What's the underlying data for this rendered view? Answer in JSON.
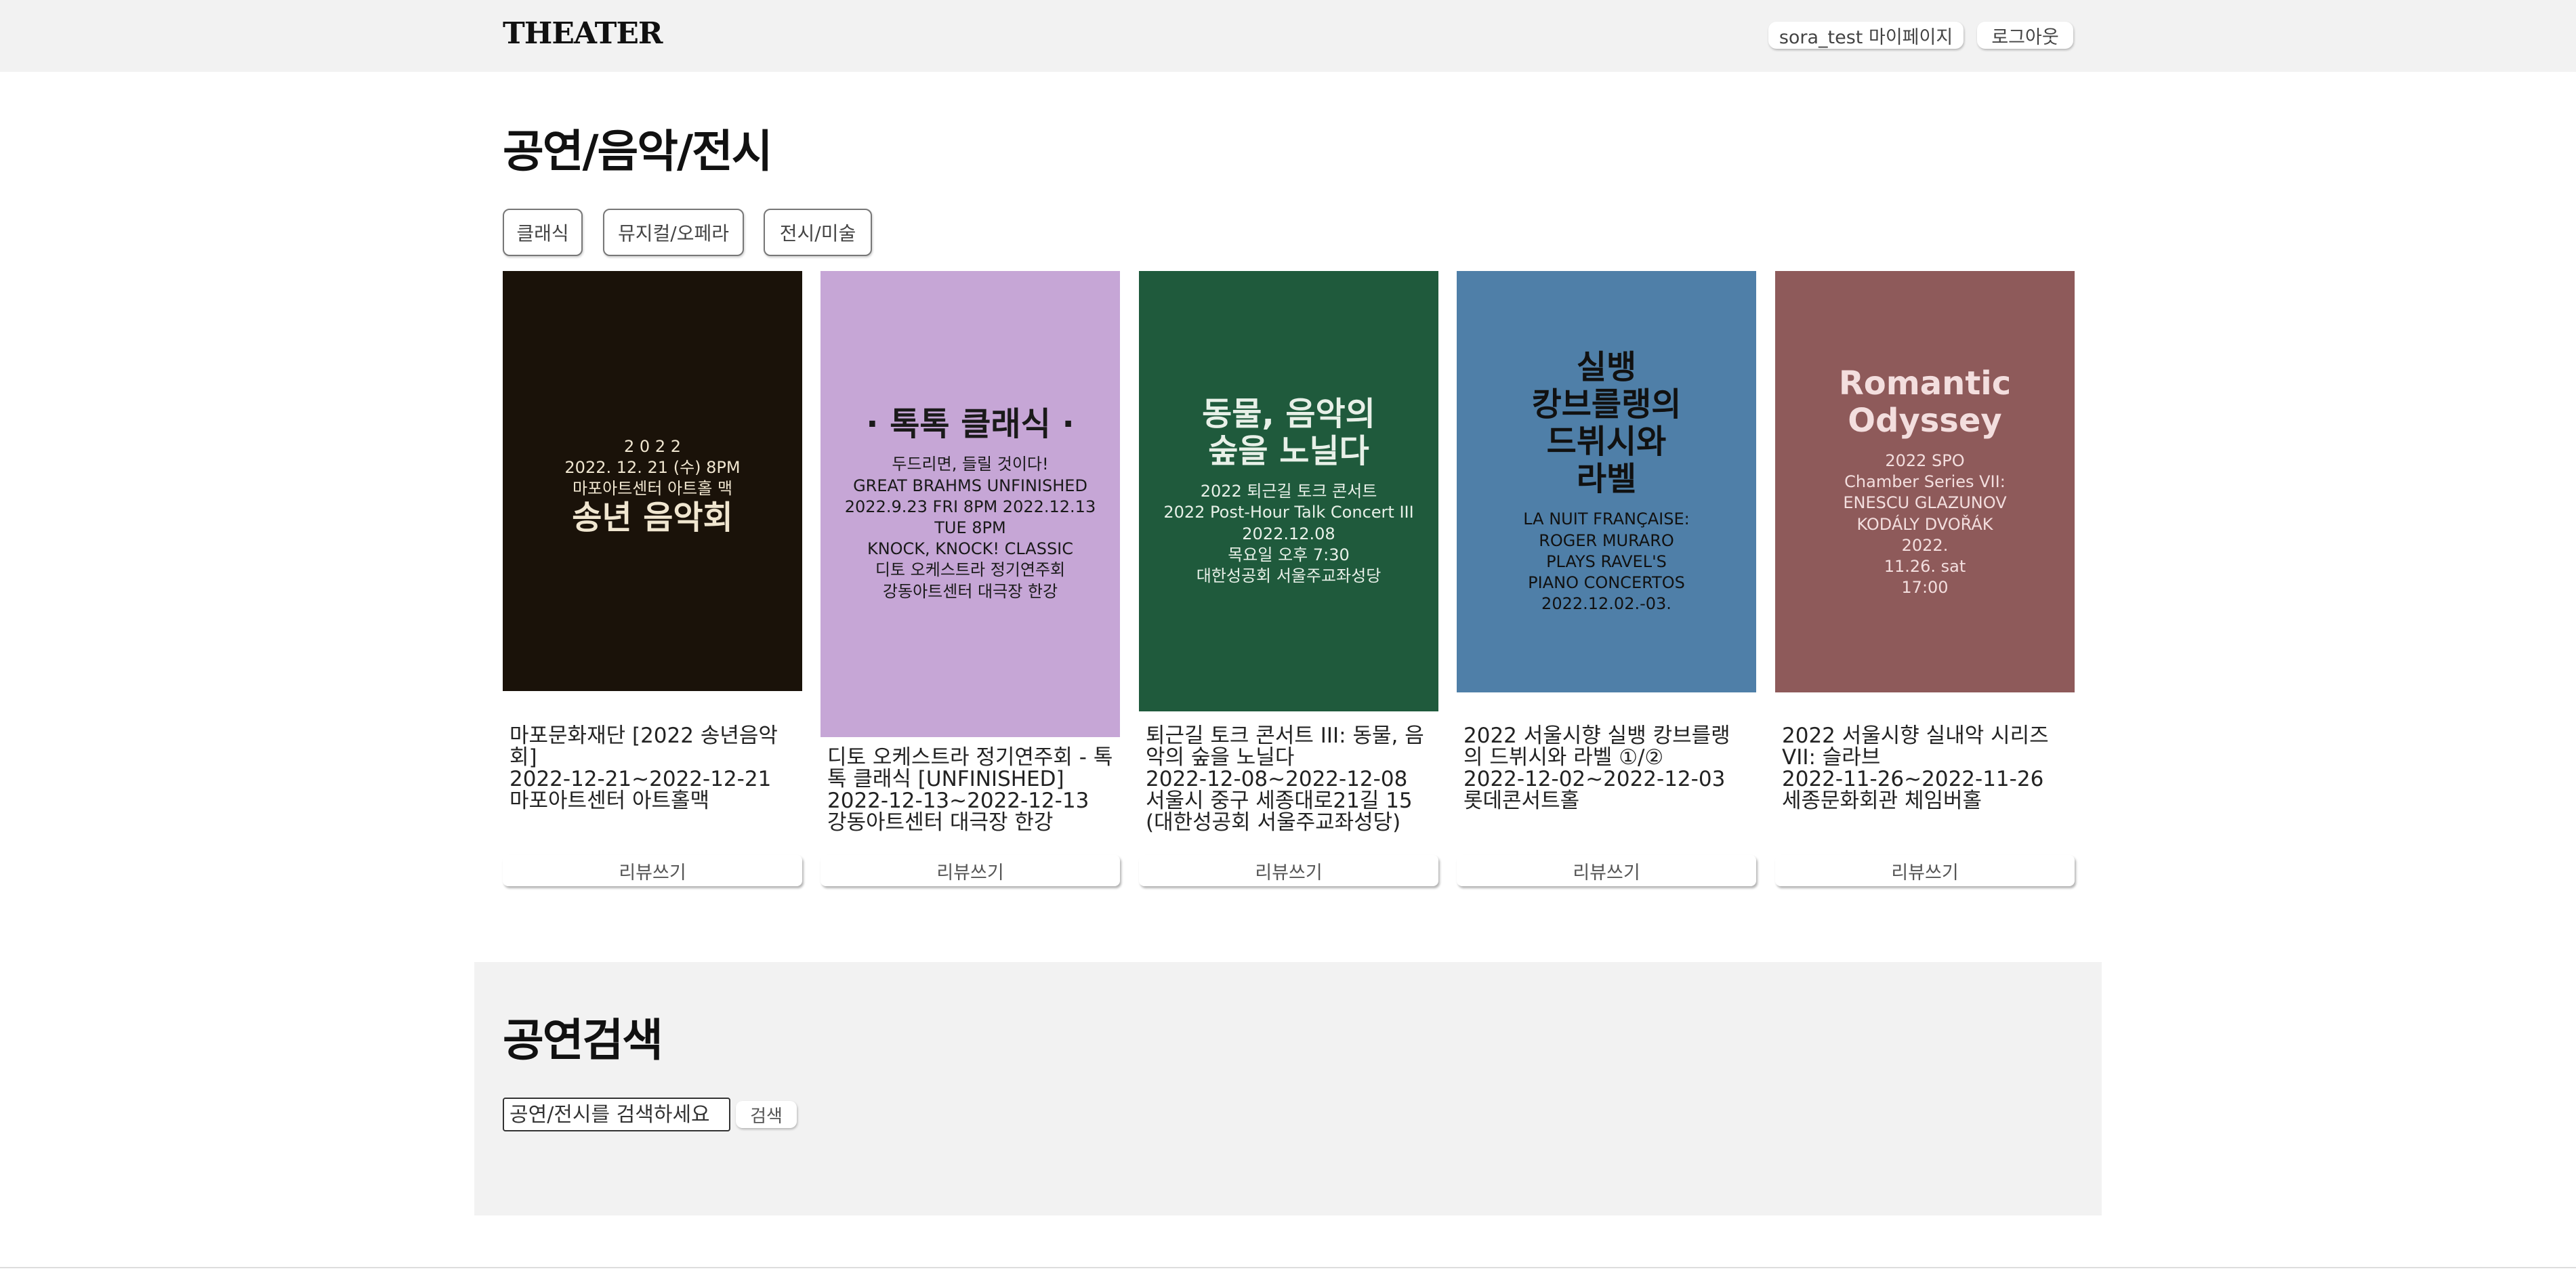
{
  "header": {
    "brand": "THEATER",
    "mypage_label": "sora_test 마이페이지",
    "logout_label": "로그아웃"
  },
  "categories_section": {
    "title": "공연/음악/전시",
    "buttons": [
      "클래식",
      "뮤지컬/오페라",
      "전시/미술"
    ]
  },
  "performances": [
    {
      "title": "마포문화재단 [2022 송년음악회]",
      "dates": "2022-12-21~2022-12-21",
      "venue": "마포아트센터 아트홀맥",
      "poster": {
        "headline": "송년 음악회",
        "sub": "2 0 2 2\n2022. 12. 21 (수) 8PM\n마포아트센터 아트홀 맥",
        "bg": "#1a1209",
        "fg": "#f0e6d0"
      },
      "review_label": "리뷰쓰기"
    },
    {
      "title": "디토 오케스트라 정기연주회 - 톡톡 클래식 [UNFINISHED]",
      "dates": "2022-12-13~2022-12-13",
      "venue": "강동아트센터 대극장 한강",
      "poster": {
        "headline": "· 톡톡 클래식 ·",
        "sub": "두드리면, 들릴 것이다!\nGREAT BRAHMS  UNFINISHED\n2022.9.23 FRI 8PM  2022.12.13 TUE 8PM\nKNOCK, KNOCK! CLASSIC\n디토 오케스트라 정기연주회\n강동아트센터 대극장 한강",
        "bg": "#c6a6d6",
        "fg": "#1a1a1a"
      },
      "review_label": "리뷰쓰기"
    },
    {
      "title": "퇴근길 토크 콘서트 III: 동물, 음악의 숲을 노닐다",
      "dates": "2022-12-08~2022-12-08",
      "venue": "서울시 중구 세종대로21길 15 (대한성공회 서울주교좌성당)",
      "poster": {
        "headline": "동물, 음악의\n숲을 노닐다",
        "sub": "2022 퇴근길 토크 콘서트\n2022 Post-Hour Talk Concert III\n2022.12.08\n목요일 오후 7:30\n대한성공회 서울주교좌성당",
        "bg": "#1f5a3c",
        "fg": "#e8f0e8"
      },
      "review_label": "리뷰쓰기"
    },
    {
      "title": "2022 서울시향 실뱅 캉브를랭의 드뷔시와 라벨 ①/②",
      "dates": "2022-12-02~2022-12-03",
      "venue": "롯데콘서트홀",
      "poster": {
        "headline": "실뱅\n캉브를랭의\n드뷔시와\n라벨",
        "sub": "LA NUIT FRANÇAISE:\nROGER MURARO\nPLAYS RAVEL'S\nPIANO CONCERTOS\n2022.12.02.-03.",
        "bg": "#4f7fa8",
        "fg": "#111111"
      },
      "review_label": "리뷰쓰기"
    },
    {
      "title": "2022 서울시향 실내악 시리즈 VII: 슬라브",
      "dates": "2022-11-26~2022-11-26",
      "venue": "세종문화회관 체임버홀",
      "poster": {
        "headline": "Romantic\nOdyssey",
        "sub": "2022 SPO\nChamber Series VII:\nENESCU  GLAZUNOV\nKODÁLY  DVOŘÁK\n2022.\n11.26. sat\n17:00",
        "bg": "#8e5a5a",
        "fg": "#f3dede"
      },
      "review_label": "리뷰쓰기"
    }
  ],
  "search_section": {
    "title": "공연검색",
    "placeholder": "공연/전시를 검색하세요",
    "button_label": "검색"
  }
}
